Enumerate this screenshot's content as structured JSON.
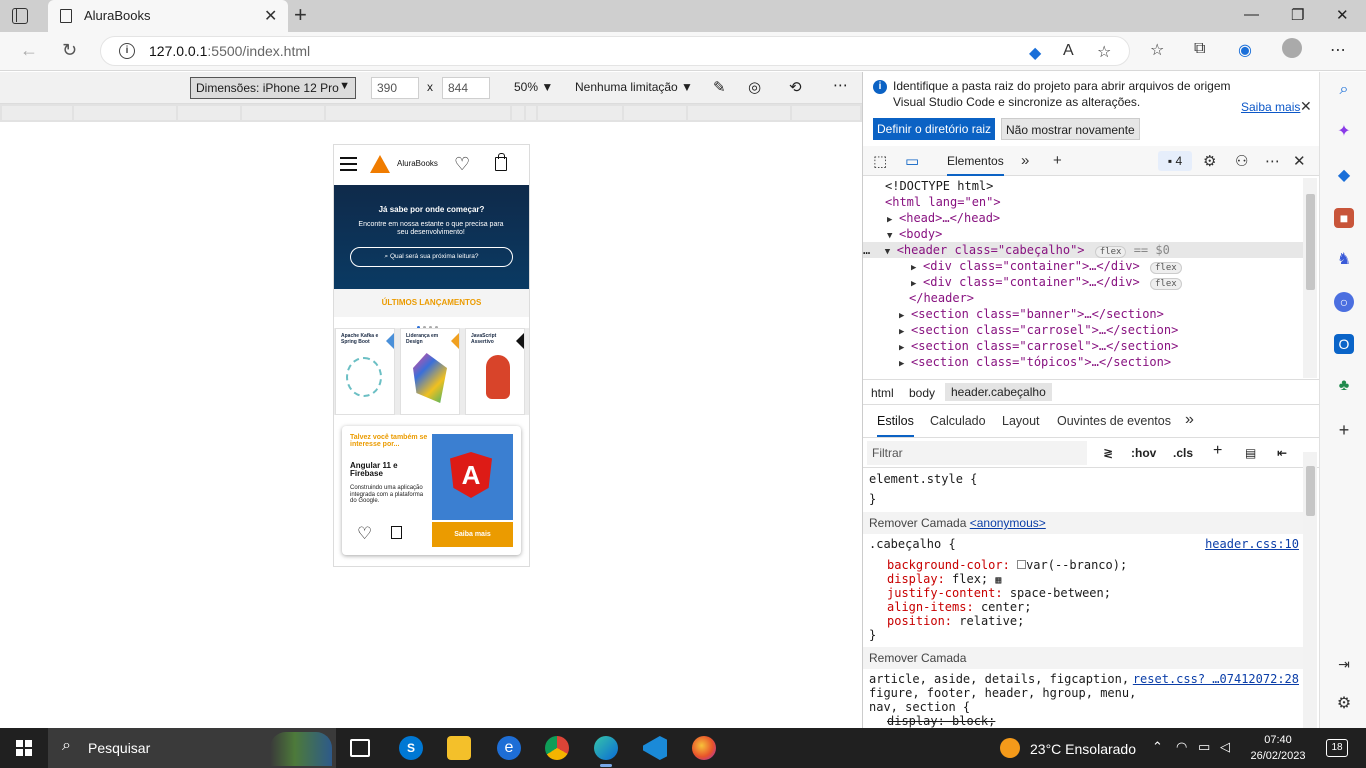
{
  "browser": {
    "tab_title": "AluraBooks",
    "url_host": "127.0.0.1",
    "url_path": ":5500/index.html"
  },
  "device_toolbar": {
    "device": "Dimensões: iPhone 12 Pro",
    "width": "390",
    "height": "844",
    "times": "x",
    "zoom": "50%",
    "throttle": "Nenhuma limitação"
  },
  "page": {
    "logo_text": "AluraBooks",
    "banner_title": "Já sabe por onde começar?",
    "banner_subtitle": "Encontre em nossa estante o que precisa para seu desenvolvimento!",
    "search_placeholder": "Qual será sua próxima leitura?",
    "section_title": "ÚLTIMOS LANÇAMENTOS",
    "books": [
      "Apache Kafka e Spring Boot",
      "Liderança em Design",
      "JavaScript Assertivo"
    ],
    "card": {
      "ask": "Talvez você também se interesse por...",
      "title": "Angular 11 e Firebase",
      "description": "Construindo uma aplicação integrada com a plataforma do Google.",
      "button": "Saiba mais",
      "logo_letter": "A"
    }
  },
  "devtools": {
    "notice_text": "Identifique a pasta raiz do projeto para abrir arquivos de origem Visual Studio Code e sincronize as alterações.",
    "notice_more": "Saiba mais",
    "notice_btn_root": "Definir o diretório raiz",
    "notice_btn_dismiss": "Não mostrar novamente",
    "panel_tab": "Elementos",
    "issues_count": "4",
    "dom": {
      "doctype": "<!DOCTYPE html>",
      "html_open": "<html lang=\"en\">",
      "head": "<head>…</head>",
      "body_open": "<body>",
      "header_open": "<header class=\"cabeçalho\">",
      "flex": "flex",
      "dollar": "== $0",
      "div1": "<div class=\"container\">…</div>",
      "div2": "<div class=\"container\">…</div>",
      "header_close": "</header>",
      "sec1": "<section class=\"banner\">…</section>",
      "sec2": "<section class=\"carrosel\">…</section>",
      "sec3": "<section class=\"carrosel\">…</section>",
      "sec4": "<section class=\"tópicos\">…</section>"
    },
    "breadcrumbs": [
      "html",
      "body",
      "header.cabeçalho"
    ],
    "style_tabs": [
      "Estilos",
      "Calculado",
      "Layout",
      "Ouvintes de eventos"
    ],
    "filter_placeholder": "Filtrar",
    "filter_hov": ":hov",
    "filter_cls": ".cls",
    "styles": {
      "element_style": "element.style {",
      "close": "}",
      "layer1": "Remover Camada",
      "layer1_link": "<anonymous>",
      "selector": ".cabeçalho {",
      "selector_src": "header.css:10",
      "p1_name": "background-color:",
      "p1_val": "var(--branco);",
      "p2_name": "display:",
      "p2_val": "flex;",
      "p3_name": "justify-content:",
      "p3_val": "space-between;",
      "p4_name": "align-items:",
      "p4_val": "center;",
      "p5_name": "position:",
      "p5_val": "relative;",
      "layer2": "Remover Camada",
      "reset_sel1": "article, aside, details, figcaption,",
      "reset_sel2": "figure, footer, header, hgroup, menu,",
      "reset_sel3": "nav, section {",
      "reset_src": "reset.css? …07412072:28",
      "reset_prop": "display: block;"
    }
  },
  "taskbar": {
    "search": "Pesquisar",
    "weather": "23°C  Ensolarado",
    "time": "07:40",
    "date": "26/02/2023",
    "notifications": "18"
  },
  "colors": {
    "accent": "#eb9b00",
    "banner": "#0f2a4a",
    "edge_blue": "#0b62c4"
  }
}
